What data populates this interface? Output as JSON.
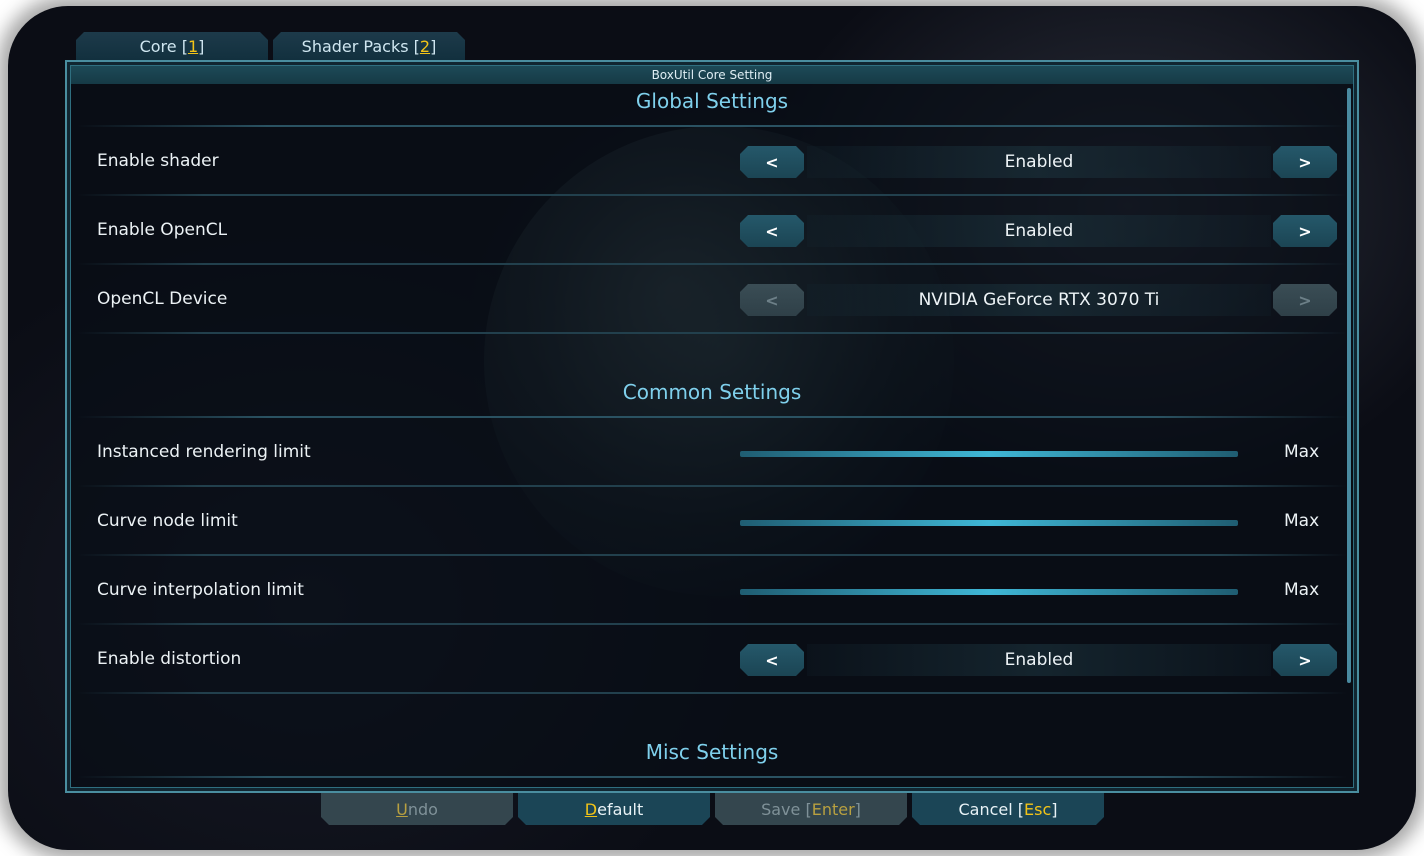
{
  "tabs": [
    {
      "label": "Core",
      "key": "1"
    },
    {
      "label": "Shader Packs",
      "key": "2"
    }
  ],
  "panel": {
    "title": "BoxUtil Core Setting"
  },
  "sections": {
    "global": "Global Settings",
    "common": "Common Settings",
    "misc": "Misc Settings"
  },
  "global_rows": [
    {
      "label": "Enable shader",
      "value": "Enabled",
      "prev": "<",
      "next": ">",
      "enabled": true
    },
    {
      "label": "Enable OpenCL",
      "value": "Enabled",
      "prev": "<",
      "next": ">",
      "enabled": true
    },
    {
      "label": "OpenCL Device",
      "value": "NVIDIA GeForce RTX 3070 Ti",
      "prev": "<",
      "next": ">",
      "enabled": false
    }
  ],
  "common_rows": [
    {
      "label": "Instanced rendering limit",
      "value": "Max",
      "level": 1.0
    },
    {
      "label": "Curve node limit",
      "value": "Max",
      "level": 1.0
    },
    {
      "label": "Curve interpolation limit",
      "value": "Max",
      "level": 1.0
    }
  ],
  "distortion_row": {
    "label": "Enable distortion",
    "value": "Enabled",
    "prev": "<",
    "next": ">"
  },
  "buttons": {
    "undo": {
      "key": "U",
      "rest": "ndo",
      "enabled": false
    },
    "default": {
      "key": "D",
      "rest": "efault",
      "enabled": true
    },
    "save": {
      "label": "Save [",
      "key": "Enter",
      "close": "]",
      "enabled": false
    },
    "cancel": {
      "label": "Cancel [",
      "key": "Esc",
      "close": "]",
      "enabled": true
    }
  },
  "colors": {
    "accent": "#7fd0ec",
    "hotkey": "#f2c418",
    "button": "#1b4556",
    "disabled": "#34464e"
  }
}
